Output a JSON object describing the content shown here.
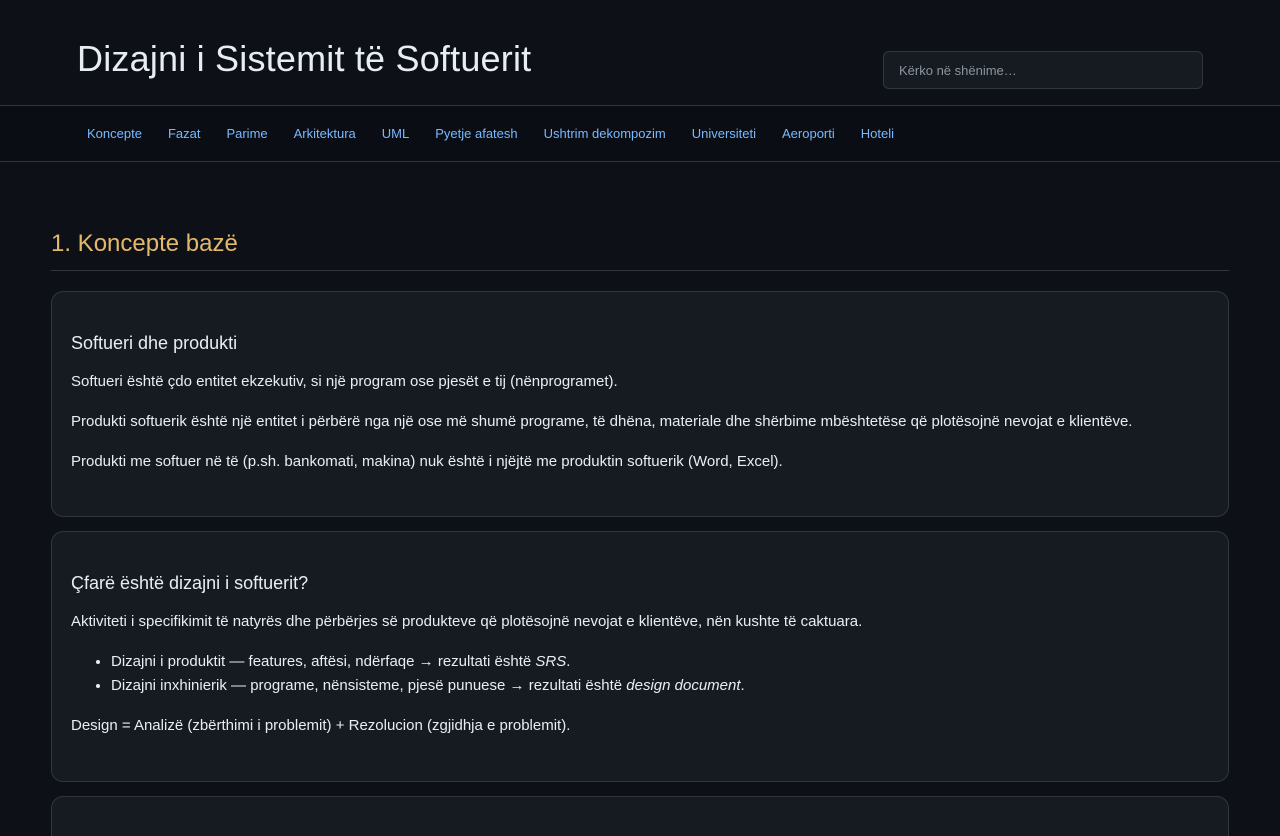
{
  "header": {
    "title": "Dizajni i Sistemit të Softuerit",
    "search_placeholder": "Kërko në shënime…"
  },
  "nav": [
    "Koncepte",
    "Fazat",
    "Parime",
    "Arkitektura",
    "UML",
    "Pyetje afatesh",
    "Ushtrim dekompozim",
    "Universiteti",
    "Aeroporti",
    "Hoteli"
  ],
  "section": {
    "title": "1. Koncepte bazë"
  },
  "card1": {
    "heading": "Softueri dhe produkti",
    "p1": "Softueri është çdo entitet ekzekutiv, si një program ose pjesët e tij (nënprogramet).",
    "p2": "Produkti softuerik është një entitet i përbërë nga një ose më shumë programe, të dhëna, materiale dhe shërbime mbështetëse që plotësojnë nevojat e klientëve.",
    "p3": "Produkti me softuer në të (p.sh. bankomati, makina) nuk është i njëjtë me produktin softuerik (Word, Excel)."
  },
  "card2": {
    "heading": "Çfarë është dizajni i softuerit?",
    "p1": "Aktiviteti i specifikimit të natyrës dhe përbërjes së produkteve që plotësojnë nevojat e klientëve, nën kushte të caktuara.",
    "li1_text": "Dizajni i produktit — features, aftësi, ndërfaqe → rezultati është ",
    "li1_em": "SRS",
    "li1_end": ".",
    "li2_text": "Dizajni inxhinierik — programe, nënsisteme, pjesë punuese → rezultati është ",
    "li2_em": "design document",
    "li2_end": ".",
    "p2": "Design = Analizë (zbërthimi i problemit) + Rezolucion (zgjidhja e problemit)."
  }
}
